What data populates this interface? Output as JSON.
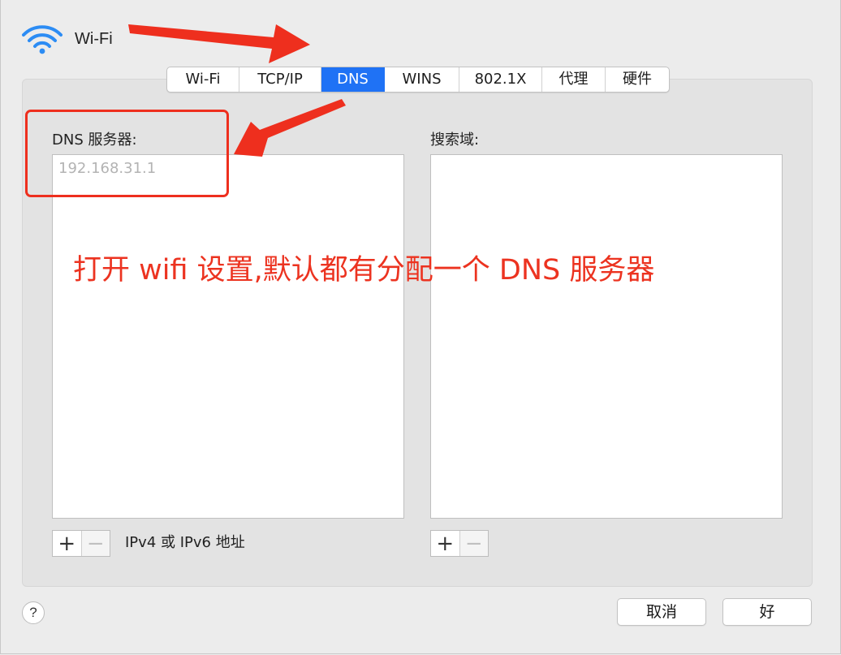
{
  "window": {
    "title": "Wi-Fi"
  },
  "tabs": [
    {
      "label": "Wi-Fi",
      "active": false
    },
    {
      "label": "TCP/IP",
      "active": false
    },
    {
      "label": "DNS",
      "active": true
    },
    {
      "label": "WINS",
      "active": false
    },
    {
      "label": "802.1X",
      "active": false
    },
    {
      "label": "代理",
      "active": false
    },
    {
      "label": "硬件",
      "active": false
    }
  ],
  "dns": {
    "label": "DNS 服务器:",
    "servers": [
      "192.168.31.1"
    ],
    "add_label": "+",
    "remove_label": "−",
    "hint": "IPv4 或 IPv6 地址"
  },
  "search_domains": {
    "label": "搜索域:",
    "entries": [],
    "add_label": "+",
    "remove_label": "−"
  },
  "footer": {
    "help_label": "?",
    "cancel_label": "取消",
    "ok_label": "好"
  },
  "annotation": {
    "text": "打开 wifi 设置,默认都有分配一个 DNS 服务器",
    "color": "#ec3320"
  },
  "colors": {
    "accent": "#1f72f5",
    "annotation": "#ec3320",
    "wifi_icon": "#2c8cf4"
  },
  "icons": {
    "wifi": "wifi-icon",
    "help": "question-icon"
  }
}
